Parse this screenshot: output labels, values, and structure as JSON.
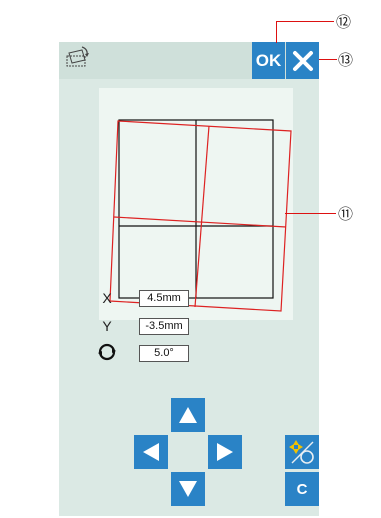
{
  "header": {
    "icon": "rotate-frame-icon",
    "ok_label": "OK",
    "cancel_icon": "close-icon"
  },
  "fields": {
    "x_label": "X",
    "x_value": "4.5mm",
    "y_label": "Y",
    "y_value": "-3.5mm",
    "rotation_icon": "rotate-circle-icon",
    "rotation_value": "5.0°"
  },
  "controls": {
    "up_icon": "arrow-up-icon",
    "left_icon": "arrow-left-icon",
    "right_icon": "arrow-right-icon",
    "down_icon": "arrow-down-icon",
    "mode_icon": "move-rotate-toggle-icon",
    "c_label": "C"
  },
  "callouts": {
    "c11": "⑪",
    "c12": "⑫",
    "c13": "⑬"
  },
  "colors": {
    "button_blue": "#2a83c6",
    "panel_bg": "#dbe9e4",
    "preview_bg": "#eef6f2",
    "outline_red": "#dd2222"
  }
}
